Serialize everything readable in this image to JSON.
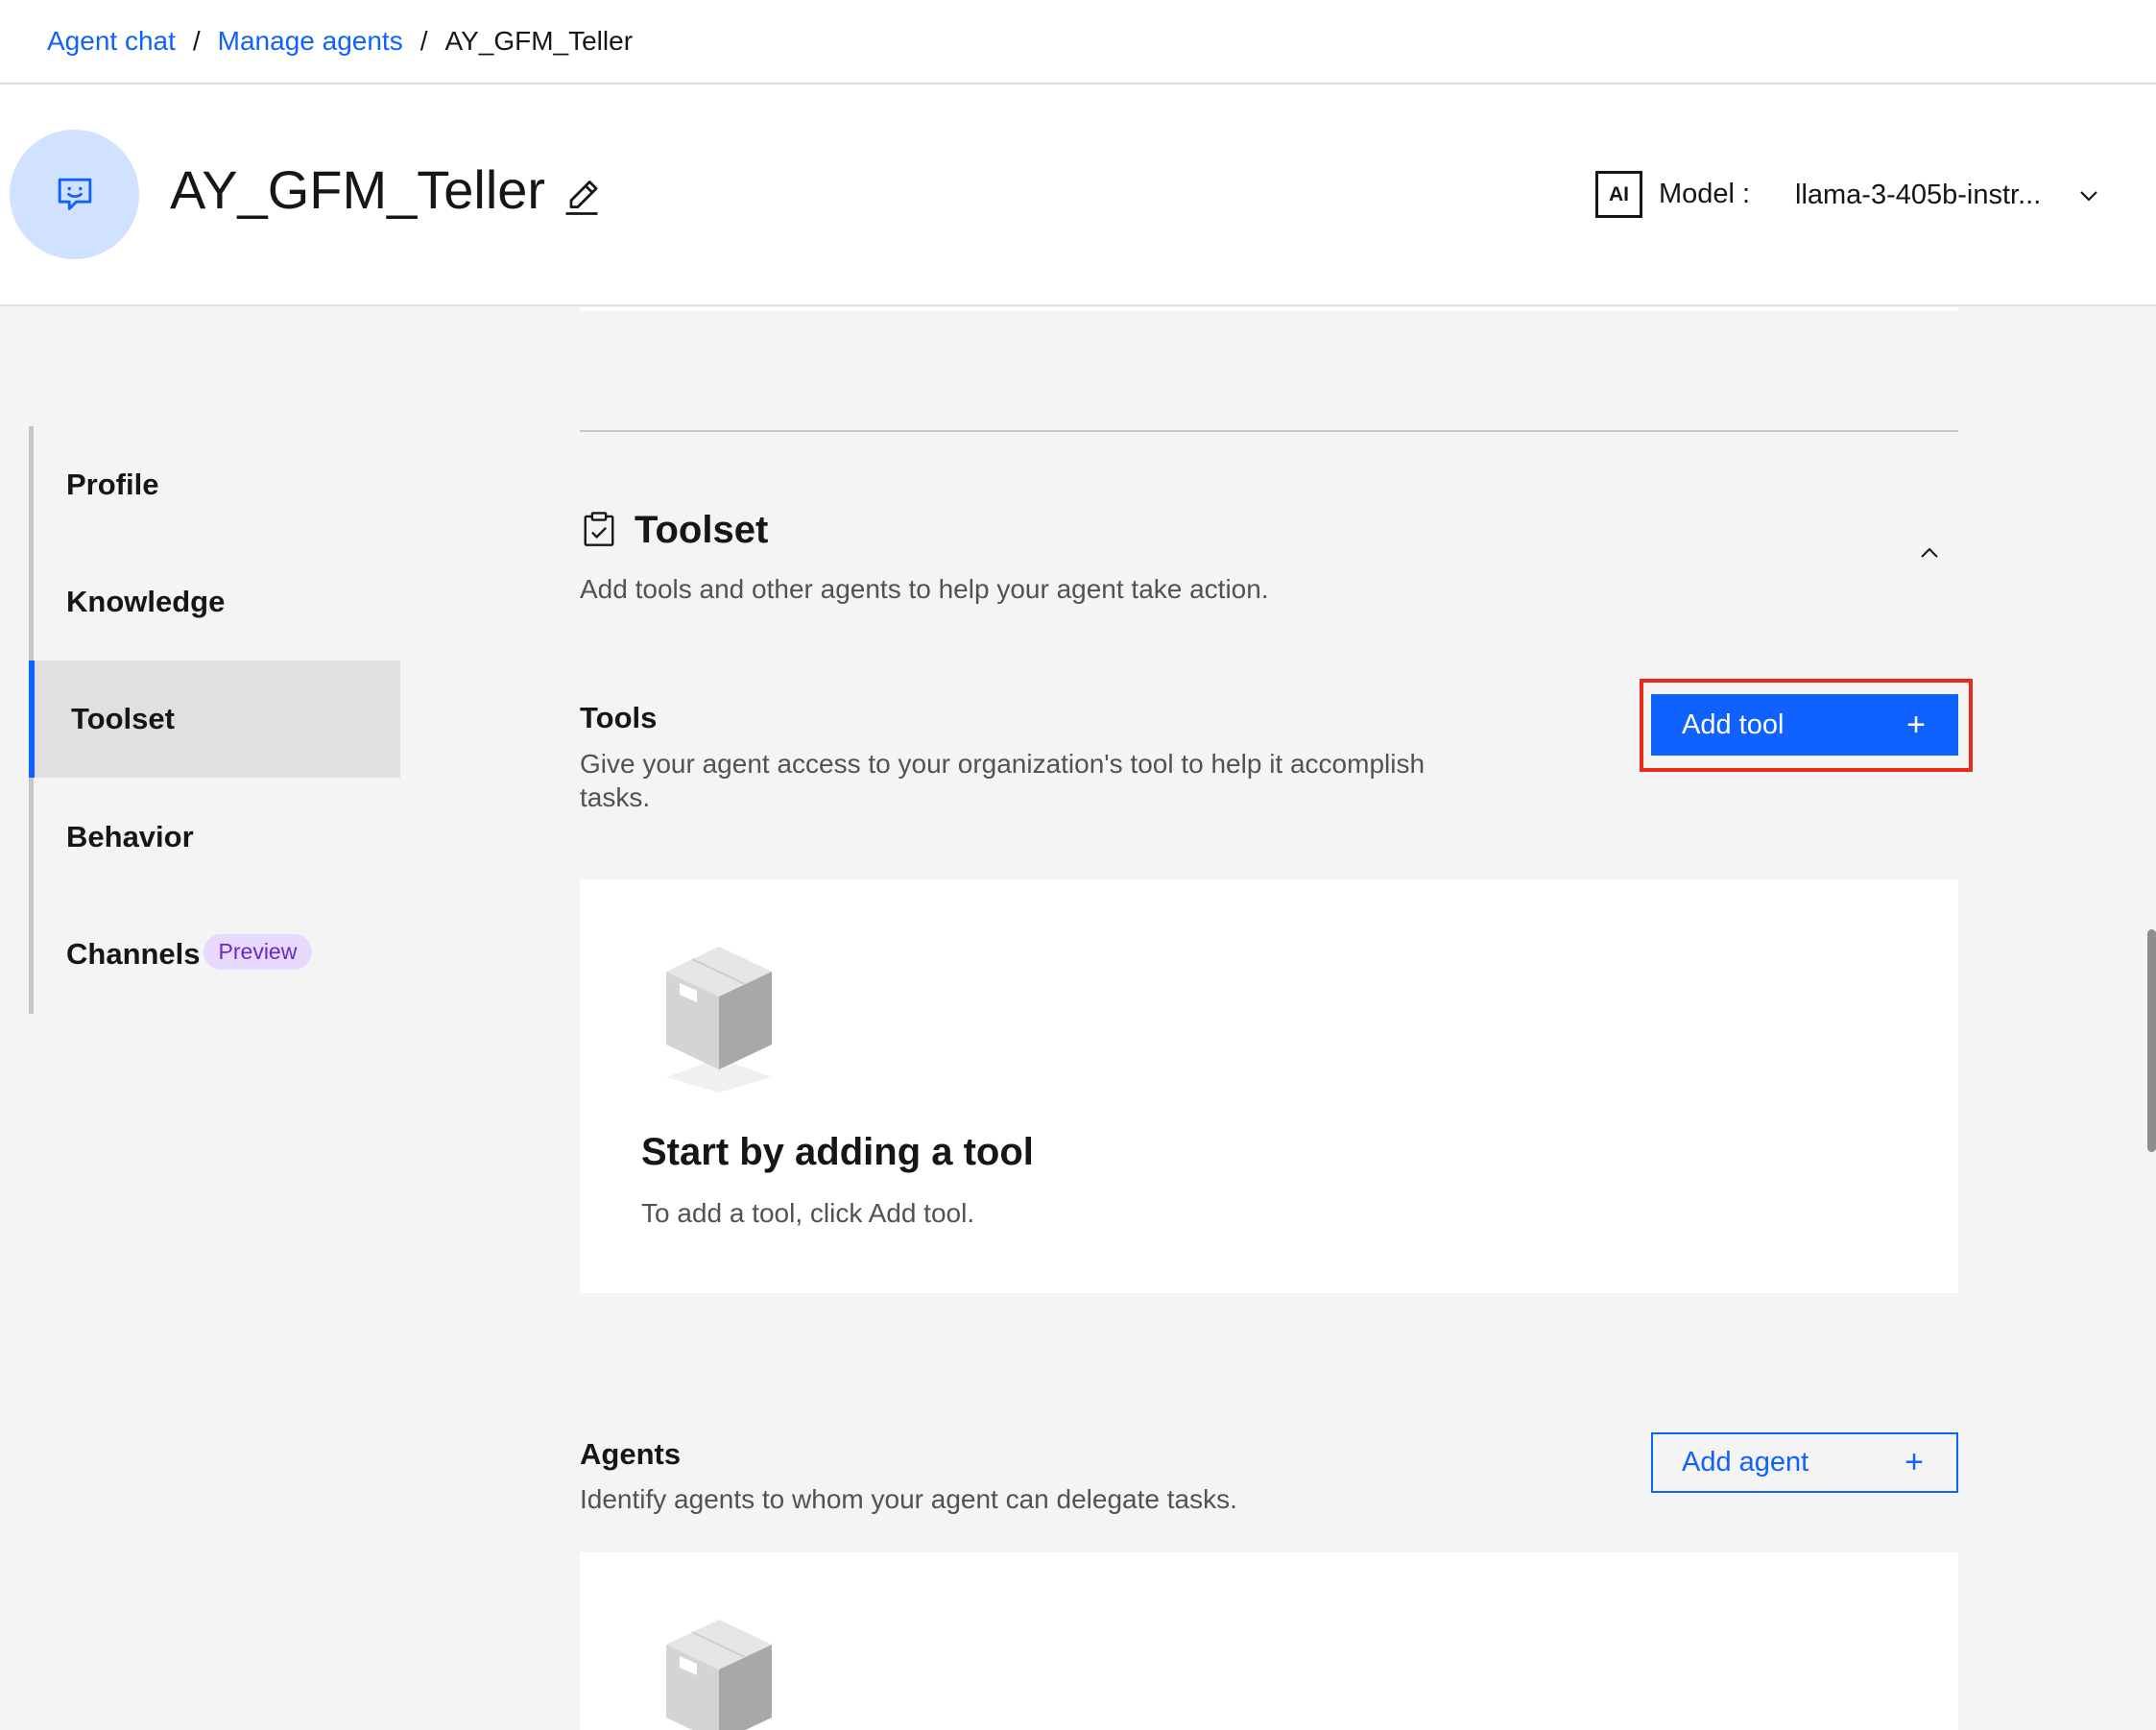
{
  "breadcrumb": {
    "items": [
      "Agent chat",
      "Manage agents"
    ],
    "separator": "/",
    "current": "AY_GFM_Teller"
  },
  "header": {
    "agent_name": "AY_GFM_Teller",
    "avatar_icon": "chat-bot-icon",
    "model_badge": "AI",
    "model_label": "Model :",
    "model_value": "llama-3-405b-instr..."
  },
  "sidenav": {
    "items": [
      {
        "label": "Profile"
      },
      {
        "label": "Knowledge"
      },
      {
        "label": "Toolset",
        "active": true
      },
      {
        "label": "Behavior"
      },
      {
        "label": "Channels",
        "tag": "Preview"
      }
    ]
  },
  "toolset": {
    "title": "Toolset",
    "icon": "clipboard-check-icon",
    "description": "Add tools and other agents to help your agent take action.",
    "tools": {
      "heading": "Tools",
      "description": "Give your agent access to your organization's tool to help it accomplish tasks.",
      "add_button": "Add tool",
      "empty_title": "Start by adding a tool",
      "empty_desc": "To add a tool, click Add tool."
    },
    "agents": {
      "heading": "Agents",
      "description": "Identify agents to whom your agent can delegate tasks.",
      "add_button": "Add agent"
    }
  },
  "colors": {
    "primary": "#0f62fe",
    "highlight": "#e8291c",
    "background": "#f4f4f4",
    "preview_tag_bg": "#e8daff",
    "preview_tag_text": "#6929c4"
  }
}
